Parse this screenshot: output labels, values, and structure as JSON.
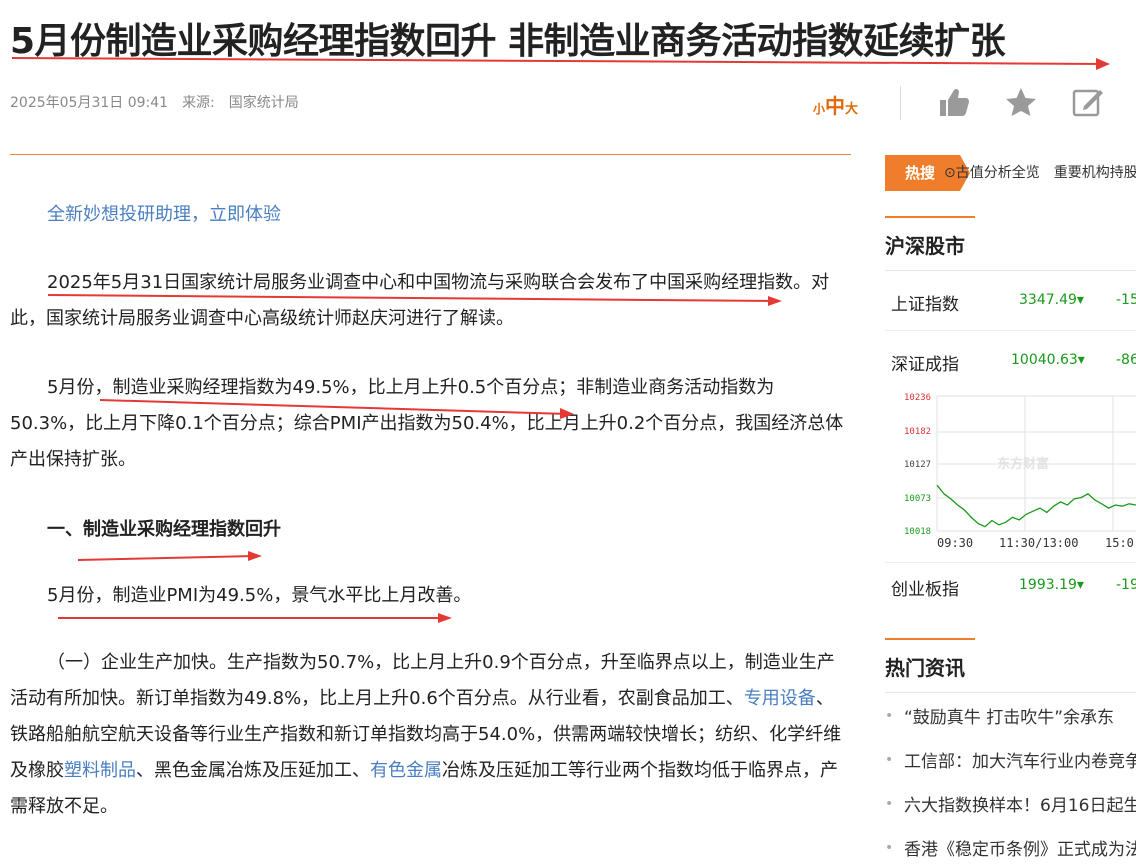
{
  "article": {
    "title": "5月份制造业采购经理指数回升 非制造业商务活动指数延续扩张",
    "date": "2025年05月31日 09:41",
    "source_label": "来源:",
    "source": "国家统计局",
    "font_sizes": [
      "小",
      "中",
      "大"
    ],
    "promo_link": "全新妙想投研助理，立即体验",
    "p1": "2025年5月31日国家统计局服务业调查中心和中国物流与采购联合会发布了中国采购经理指数。对此，国家统计局服务业调查中心高级统计师赵庆河进行了解读。",
    "p2": "5月份，制造业采购经理指数为49.5%，比上月上升0.5个百分点；非制造业商务活动指数为50.3%，比上月下降0.1个百分点；综合PMI产出指数为50.4%，比上月上升0.2个百分点，我国经济总体产出保持扩张。",
    "h1": "一、制造业采购经理指数回升",
    "p3": "5月份，制造业PMI为49.5%，景气水平比上月改善。",
    "p4": {
      "a": "（一）企业生产加快。生产指数为50.7%，比上月上升0.9个百分点，升至临界点以上，制造业生产活动有所加快。新订单指数为49.8%，比上月上升0.6个百分点。从行业看，农副食品加工、",
      "link1": "专用设备",
      "b": "、铁路船舶航空航天设备等行业生产指数和新订单指数均高于54.0%，供需两端较快增长；纺织、化学纤维及橡胶",
      "link2": "塑料制品",
      "c": "、黑色金属冶炼及压延加工、",
      "link3": "有色金属",
      "d": "冶炼及压延加工等行业两个指数均低于临界点，产需释放不足。"
    }
  },
  "sidebar": {
    "hot_search_label": "热搜",
    "hot_search_ticker": "⊙古值分析全览　重要机构持股",
    "market_title": "沪深股市",
    "indices": [
      {
        "name": "上证指数",
        "value": "3347.49▾",
        "change": "-15"
      },
      {
        "name": "深证成指",
        "value": "10040.63▾",
        "change": "-86"
      },
      {
        "name": "创业板指",
        "value": "1993.19▾",
        "change": "-19"
      }
    ],
    "news_title": "热门资讯",
    "news": [
      "“鼓励真牛 打击吹牛”余承东",
      "工信部：加大汽车行业内卷竞争",
      "六大指数换样本！6月16日起生",
      "香港《稳定币条例》正式成为法"
    ]
  },
  "chart_data": {
    "type": "line",
    "y_ticks": [
      "10236",
      "10182",
      "10127",
      "10073",
      "10018"
    ],
    "x_ticks": [
      "09:30",
      "11:30/13:00",
      "15:0"
    ],
    "ylim": [
      10018,
      10236
    ],
    "watermark": "东方财富",
    "values": [
      10092,
      10078,
      10070,
      10060,
      10052,
      10040,
      10030,
      10025,
      10035,
      10028,
      10032,
      10040,
      10036,
      10045,
      10050,
      10055,
      10048,
      10058,
      10065,
      10060,
      10070,
      10072,
      10078,
      10068,
      10062,
      10055,
      10060,
      10058,
      10062,
      10060
    ]
  }
}
